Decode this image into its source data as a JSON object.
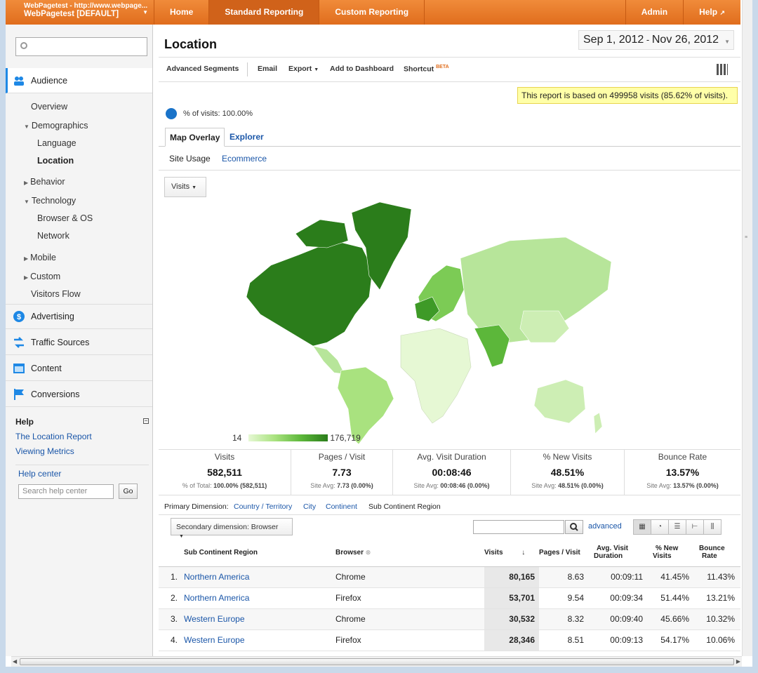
{
  "account": {
    "url": "WebPagetest - http://www.webpage...",
    "profile": "WebPagetest [DEFAULT]"
  },
  "nav": {
    "home": "Home",
    "standard": "Standard Reporting",
    "custom": "Custom Reporting",
    "admin": "Admin",
    "help": "Help"
  },
  "sidebar": {
    "audience": "Audience",
    "overview": "Overview",
    "demographics": "Demographics",
    "language": "Language",
    "location": "Location",
    "behavior": "Behavior",
    "technology": "Technology",
    "browser_os": "Browser & OS",
    "network": "Network",
    "mobile": "Mobile",
    "custom": "Custom",
    "visitors_flow": "Visitors Flow",
    "advertising": "Advertising",
    "traffic": "Traffic Sources",
    "content": "Content",
    "conversions": "Conversions",
    "help_title": "Help",
    "help_link1": "The Location Report",
    "help_link2": "Viewing Metrics",
    "help_center": "Help center",
    "search_placeholder": "Search help center",
    "go": "Go"
  },
  "report": {
    "title": "Location",
    "date_start": "Sep 1, 2012",
    "date_end": "Nov 26, 2012",
    "toolbar": {
      "segments": "Advanced Segments",
      "email": "Email",
      "export": "Export",
      "dashboard": "Add to Dashboard",
      "shortcut": "Shortcut",
      "beta": "BETA"
    },
    "notice": "This report is based on 499958 visits (85.62% of visits).",
    "pct_visits": "% of visits: 100.00%",
    "tab_map": "Map Overlay",
    "tab_explorer": "Explorer",
    "subtab_usage": "Site Usage",
    "subtab_ecom": "Ecommerce",
    "metric": "Visits",
    "legend_min": "14",
    "legend_max": "176,719"
  },
  "summary": [
    {
      "label": "Visits",
      "value": "582,511",
      "sub_label": "% of Total:",
      "sub_value": "100.00% (582,511)"
    },
    {
      "label": "Pages / Visit",
      "value": "7.73",
      "sub_label": "Site Avg:",
      "sub_value": "7.73 (0.00%)"
    },
    {
      "label": "Avg. Visit Duration",
      "value": "00:08:46",
      "sub_label": "Site Avg:",
      "sub_value": "00:08:46 (0.00%)"
    },
    {
      "label": "% New Visits",
      "value": "48.51%",
      "sub_label": "Site Avg:",
      "sub_value": "48.51% (0.00%)"
    },
    {
      "label": "Bounce Rate",
      "value": "13.57%",
      "sub_label": "Site Avg:",
      "sub_value": "13.57% (0.00%)"
    }
  ],
  "dimensions": {
    "label": "Primary Dimension:",
    "country": "Country / Territory",
    "city": "City",
    "continent": "Continent",
    "subcontinent": "Sub Continent Region",
    "secondary": "Secondary dimension: Browser",
    "advanced": "advanced"
  },
  "table": {
    "headers": {
      "region": "Sub Continent Region",
      "browser": "Browser",
      "visits": "Visits",
      "ppv": "Pages / Visit",
      "dur1": "Avg. Visit",
      "dur2": "Duration",
      "new1": "% New",
      "new2": "Visits",
      "bounce1": "Bounce",
      "bounce2": "Rate"
    },
    "rows": [
      {
        "n": "1.",
        "region": "Northern America",
        "browser": "Chrome",
        "visits": "80,165",
        "ppv": "8.63",
        "dur": "00:09:11",
        "new": "41.45%",
        "bounce": "11.43%"
      },
      {
        "n": "2.",
        "region": "Northern America",
        "browser": "Firefox",
        "visits": "53,701",
        "ppv": "9.54",
        "dur": "00:09:34",
        "new": "51.44%",
        "bounce": "13.21%"
      },
      {
        "n": "3.",
        "region": "Western Europe",
        "browser": "Chrome",
        "visits": "30,532",
        "ppv": "8.32",
        "dur": "00:09:40",
        "new": "45.66%",
        "bounce": "10.32%"
      },
      {
        "n": "4.",
        "region": "Western Europe",
        "browser": "Firefox",
        "visits": "28,346",
        "ppv": "8.51",
        "dur": "00:09:13",
        "new": "54.17%",
        "bounce": "10.06%"
      }
    ]
  },
  "colors": {
    "nav": "#e8792a",
    "link": "#1a56a8",
    "map_dark": "#2b7d1b",
    "map_light": "#e6f8d4"
  }
}
